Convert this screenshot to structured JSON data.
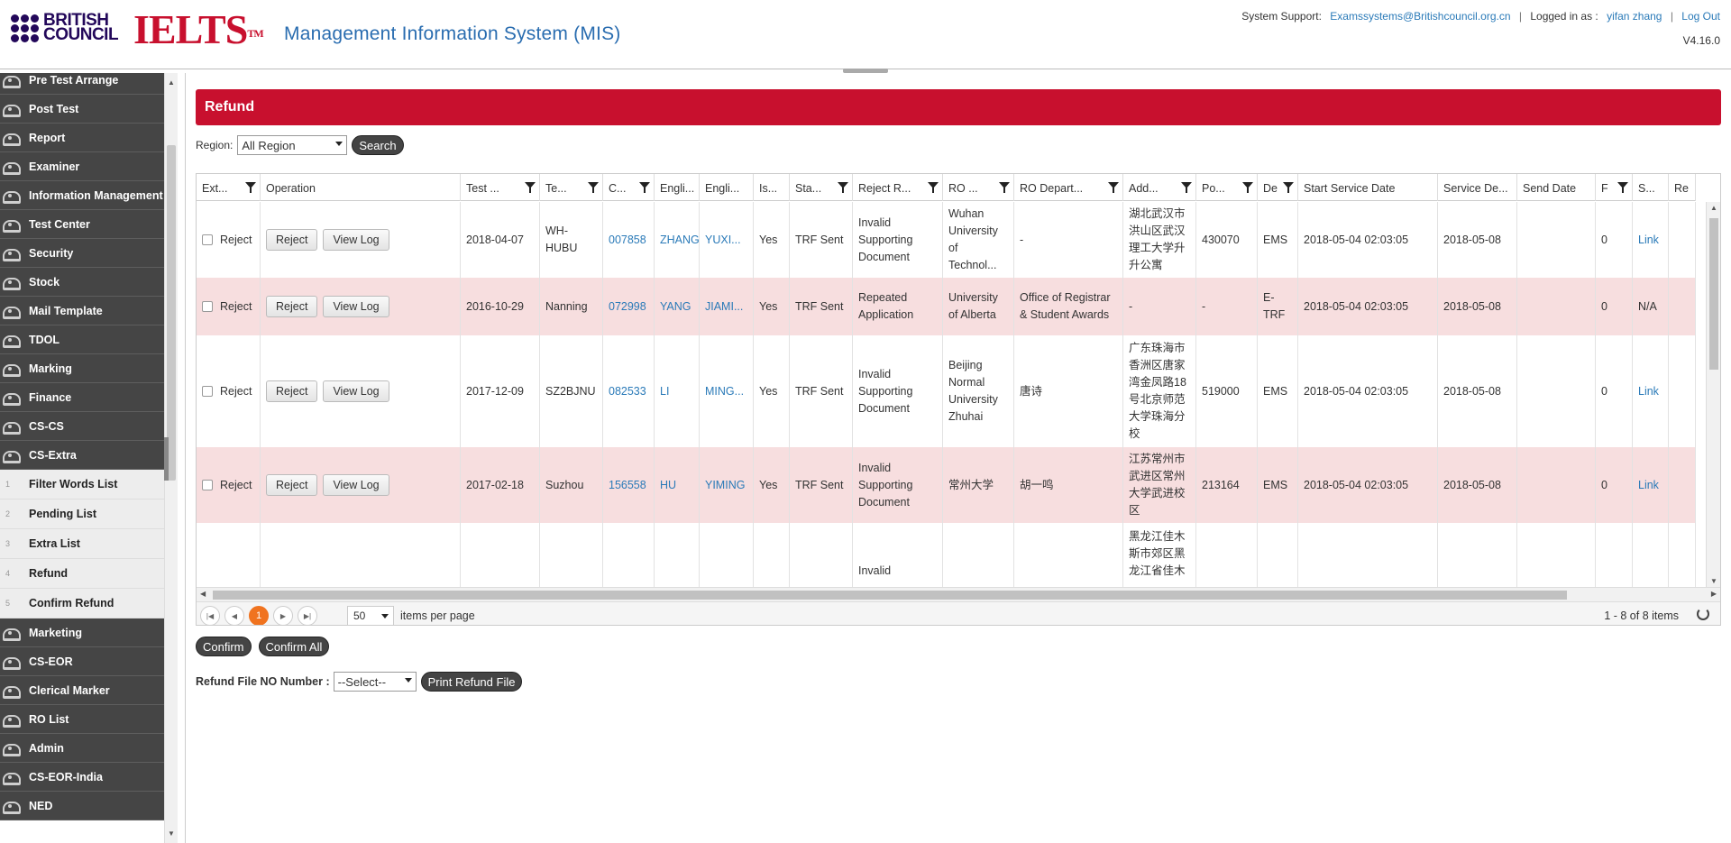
{
  "header": {
    "logo_text": "BRITISH\nCOUNCIL",
    "ielts": "IELTS",
    "title": "Management Information System (MIS)",
    "support_label": "System Support:",
    "support_email": "Examssystems@Britishcouncil.org.cn",
    "logged_label": "Logged in as :",
    "user": "yifan zhang",
    "logout": "Log Out",
    "version": "V4.16.0"
  },
  "sidebar": {
    "items": [
      {
        "label": "Pre Test Arrange"
      },
      {
        "label": "Post Test"
      },
      {
        "label": "Report"
      },
      {
        "label": "Examiner"
      },
      {
        "label": "Information Management"
      },
      {
        "label": "Test Center"
      },
      {
        "label": "Security"
      },
      {
        "label": "Stock"
      },
      {
        "label": "Mail Template"
      },
      {
        "label": "TDOL"
      },
      {
        "label": "Marking"
      },
      {
        "label": "Finance"
      },
      {
        "label": "CS-CS"
      },
      {
        "label": "CS-Extra"
      }
    ],
    "sub_items": [
      {
        "num": "1",
        "label": "Filter Words List"
      },
      {
        "num": "2",
        "label": "Pending List"
      },
      {
        "num": "3",
        "label": "Extra List"
      },
      {
        "num": "4",
        "label": "Refund"
      },
      {
        "num": "5",
        "label": "Confirm Refund"
      }
    ],
    "items_after": [
      {
        "label": "Marketing"
      },
      {
        "label": "CS-EOR"
      },
      {
        "label": "Clerical Marker"
      },
      {
        "label": "RO List"
      },
      {
        "label": "Admin"
      },
      {
        "label": "CS-EOR-India"
      },
      {
        "label": "NED"
      }
    ]
  },
  "page": {
    "title": "Refund",
    "region_label": "Region:",
    "region_value": "All Region",
    "search": "Search"
  },
  "grid": {
    "columns": [
      {
        "label": "Ext...",
        "filter": true
      },
      {
        "label": "Operation",
        "filter": false
      },
      {
        "label": "Test ...",
        "filter": true
      },
      {
        "label": "Te...",
        "filter": true
      },
      {
        "label": "C...",
        "filter": true
      },
      {
        "label": "Engli...",
        "filter": false
      },
      {
        "label": "Engli...",
        "filter": false
      },
      {
        "label": "Is...",
        "filter": false
      },
      {
        "label": "Sta...",
        "filter": true
      },
      {
        "label": "Reject R...",
        "filter": true
      },
      {
        "label": "RO ...",
        "filter": true
      },
      {
        "label": "RO Depart...",
        "filter": true
      },
      {
        "label": "Add...",
        "filter": true
      },
      {
        "label": "Po...",
        "filter": true
      },
      {
        "label": "De",
        "filter": true
      },
      {
        "label": "Start Service Date",
        "filter": false
      },
      {
        "label": "Service De...",
        "filter": false
      },
      {
        "label": "Send Date",
        "filter": false
      },
      {
        "label": "F",
        "filter": true
      },
      {
        "label": "S...",
        "filter": false
      },
      {
        "label": "Re",
        "filter": false
      }
    ],
    "reject_label": "Reject",
    "btn_reject": "Reject",
    "btn_viewlog": "View Log",
    "rows": [
      {
        "date": "2018-04-07",
        "center": "WH-HUBU",
        "code": "007858",
        "en1": "ZHANG",
        "en2": "YUXI...",
        "is": "Yes",
        "status": "TRF Sent",
        "reason": "Invalid Supporting Document",
        "ro": "Wuhan University of Technol...",
        "dept": "-",
        "addr": "湖北武汉市洪山区武汉理工大学升升公寓",
        "post": "430070",
        "de": "EMS",
        "start": "2018-05-04 02:03:05",
        "service": "2018-05-08",
        "send": "",
        "f": "0",
        "s": "Link"
      },
      {
        "date": "2016-10-29",
        "center": "Nanning",
        "code": "072998",
        "en1": "YANG",
        "en2": "JIAMI...",
        "is": "Yes",
        "status": "TRF Sent",
        "reason": "Repeated Application",
        "ro": "University of Alberta",
        "dept": "Office of Registrar & Student Awards",
        "addr": "-",
        "post": "-",
        "de": "E-TRF",
        "start": "2018-05-04 02:03:05",
        "service": "2018-05-08",
        "send": "",
        "f": "0",
        "s": "N/A"
      },
      {
        "date": "2017-12-09",
        "center": "SZ2BJNU",
        "code": "082533",
        "en1": "LI",
        "en2": "MING...",
        "is": "Yes",
        "status": "TRF Sent",
        "reason": "Invalid Supporting Document",
        "ro": "Beijing Normal University Zhuhai",
        "dept": "唐诗",
        "addr": "广东珠海市香洲区唐家湾金凤路18号北京师范大学珠海分校",
        "post": "519000",
        "de": "EMS",
        "start": "2018-05-04 02:03:05",
        "service": "2018-05-08",
        "send": "",
        "f": "0",
        "s": "Link"
      },
      {
        "date": "2017-02-18",
        "center": "Suzhou",
        "code": "156558",
        "en1": "HU",
        "en2": "YIMING",
        "is": "Yes",
        "status": "TRF Sent",
        "reason": "Invalid Supporting Document",
        "ro": "常州大学",
        "dept": "胡一鸣",
        "addr": "江苏常州市武进区常州大学武进校区",
        "post": "213164",
        "de": "EMS",
        "start": "2018-05-04 02:03:05",
        "service": "2018-05-08",
        "send": "",
        "f": "0",
        "s": "Link"
      },
      {
        "reason": "Invalid",
        "addr": "黑龙江佳木斯市郊区黑龙江省佳木"
      }
    ]
  },
  "pager": {
    "current": "1",
    "page_size": "50",
    "label": "items per page",
    "info": "1 - 8 of 8 items"
  },
  "actions": {
    "confirm": "Confirm",
    "confirm_all": "Confirm All",
    "refund_label": "Refund File NO Number :",
    "refund_select": "--Select--",
    "print": "Print Refund File"
  },
  "colors": {
    "brand_red": "#c8102e",
    "nav_bg": "#454545",
    "row_alt": "#f7dedf",
    "link": "#2a7ab8",
    "pager_current": "#f0731f"
  }
}
